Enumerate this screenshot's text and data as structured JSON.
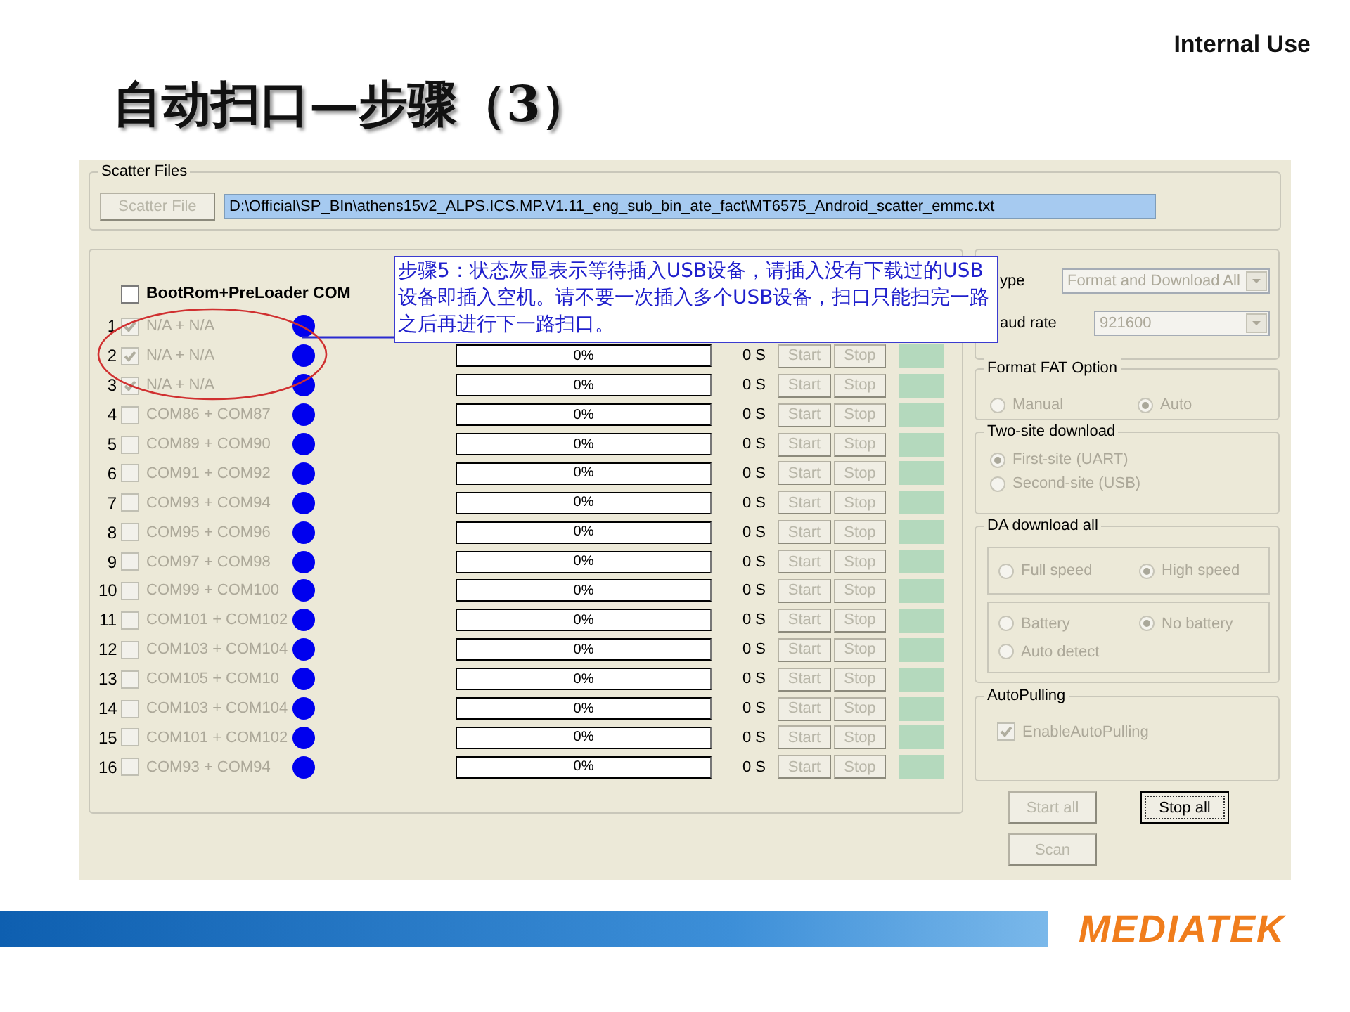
{
  "slide": {
    "classification": "Internal Use",
    "title": "自动扫口—步骤（3）",
    "logo": "MEDIATEK"
  },
  "scatter": {
    "group_label": "Scatter Files",
    "button": "Scatter File",
    "path": "D:\\Official\\SP_BIn\\athens15v2_ALPS.ICS.MP.V1.11_eng_sub_bin_ate_fact\\MT6575_Android_scatter_emmc.txt"
  },
  "ports": {
    "header": {
      "label": "BootRom+PreLoader COM",
      "checked": false
    },
    "rows": [
      {
        "number": "1",
        "label": "N/A + N/A",
        "checked": true
      },
      {
        "number": "2",
        "label": "N/A + N/A",
        "checked": true,
        "progress": {
          "text": "0%",
          "level": 0
        },
        "time": "0 S",
        "buttons": [
          "Start",
          "Stop"
        ],
        "status_box": true
      },
      {
        "number": "3",
        "label": "N/A + N/A",
        "checked": true,
        "progress": {
          "text": "0%",
          "level": 0
        },
        "time": "0 S",
        "buttons": [
          "Start",
          "Stop"
        ],
        "status_box": true
      },
      {
        "number": "4",
        "label": "COM86 + COM87",
        "checked": false,
        "progress": {
          "text": "0%",
          "level": 0
        },
        "time": "0 S",
        "buttons": [
          "Start",
          "Stop"
        ],
        "status_box": true
      },
      {
        "number": "5",
        "label": "COM89 + COM90",
        "checked": false,
        "progress": {
          "text": "0%",
          "level": 0
        },
        "time": "0 S",
        "buttons": [
          "Start",
          "Stop"
        ],
        "status_box": true
      },
      {
        "number": "6",
        "label": "COM91 + COM92",
        "checked": false,
        "progress": {
          "text": "0%",
          "level": 0
        },
        "time": "0 S",
        "buttons": [
          "Start",
          "Stop"
        ],
        "status_box": true
      },
      {
        "number": "7",
        "label": "COM93 + COM94",
        "checked": false,
        "progress": {
          "text": "0%",
          "level": 0
        },
        "time": "0 S",
        "buttons": [
          "Start",
          "Stop"
        ],
        "status_box": true
      },
      {
        "number": "8",
        "label": "COM95 + COM96",
        "checked": false,
        "progress": {
          "text": "0%",
          "level": 0
        },
        "time": "0 S",
        "buttons": [
          "Start",
          "Stop"
        ],
        "status_box": true
      },
      {
        "number": "9",
        "label": "COM97 + COM98",
        "checked": false,
        "progress": {
          "text": "0%",
          "level": 0
        },
        "time": "0 S",
        "buttons": [
          "Start",
          "Stop"
        ],
        "status_box": true
      },
      {
        "number": "10",
        "label": "COM99 + COM100",
        "checked": false,
        "progress": {
          "text": "0%",
          "level": 0
        },
        "time": "0 S",
        "buttons": [
          "Start",
          "Stop"
        ],
        "status_box": true
      },
      {
        "number": "11",
        "label": "COM101 + COM102",
        "checked": false,
        "progress": {
          "text": "0%",
          "level": 0
        },
        "time": "0 S",
        "buttons": [
          "Start",
          "Stop"
        ],
        "status_box": true
      },
      {
        "number": "12",
        "label": "COM103 + COM104",
        "checked": false,
        "progress": {
          "text": "0%",
          "level": 0
        },
        "time": "0 S",
        "buttons": [
          "Start",
          "Stop"
        ],
        "status_box": true
      },
      {
        "number": "13",
        "label": "COM105 + COM10",
        "checked": false,
        "progress": {
          "text": "0%",
          "level": 0
        },
        "time": "0 S",
        "buttons": [
          "Start",
          "Stop"
        ],
        "status_box": true
      },
      {
        "number": "14",
        "label": "COM103 + COM104",
        "checked": false,
        "progress": {
          "text": "0%",
          "level": 0
        },
        "time": "0 S",
        "buttons": [
          "Start",
          "Stop"
        ],
        "status_box": true
      },
      {
        "number": "15",
        "label": "COM101 + COM102",
        "checked": false,
        "progress": {
          "text": "0%",
          "level": 0
        },
        "time": "0 S",
        "buttons": [
          "Start",
          "Stop"
        ],
        "status_box": true
      },
      {
        "number": "16",
        "label": "COM93 + COM94",
        "checked": false,
        "progress": {
          "text": "0%",
          "level": 0
        },
        "time": "0 S",
        "buttons": [
          "Start",
          "Stop"
        ],
        "status_box": true
      }
    ]
  },
  "callout": {
    "text": "步骤5：状态灰显表示等待插入USB设备，请插入没有下载过的USB设备即插入空机。请不要一次插入多个USB设备，扫口只能扫完一路之后再进行下一路扫口。"
  },
  "settings": {
    "type": {
      "label": "ype",
      "value": "Format and Download All"
    },
    "baud_rate": {
      "label": "aud rate",
      "value": "921600"
    },
    "format_fat": {
      "title": "Format FAT Option",
      "options": [
        {
          "label": "Manual",
          "selected": false
        },
        {
          "label": "Auto",
          "selected": true
        }
      ]
    },
    "two_site": {
      "title": "Two-site download",
      "options": [
        {
          "label": "First-site (UART)",
          "selected": true
        },
        {
          "label": "Second-site (USB)",
          "selected": false
        }
      ]
    },
    "da_download": {
      "title": "DA download all",
      "speed": [
        {
          "label": "Full speed",
          "selected": false
        },
        {
          "label": "High speed",
          "selected": true
        }
      ],
      "battery": [
        {
          "label": "Battery",
          "selected": false
        },
        {
          "label": "No battery",
          "selected": true
        },
        {
          "label": "Auto detect",
          "selected": false
        }
      ]
    },
    "auto_pulling": {
      "title": "AutoPulling",
      "label": "EnableAutoPulling",
      "checked": true
    },
    "buttons": [
      {
        "label": "Start all",
        "disabled": true,
        "focused": false
      },
      {
        "label": "Stop all",
        "disabled": false,
        "focused": true
      },
      {
        "label": "Scan",
        "disabled": true,
        "focused": false
      }
    ]
  }
}
